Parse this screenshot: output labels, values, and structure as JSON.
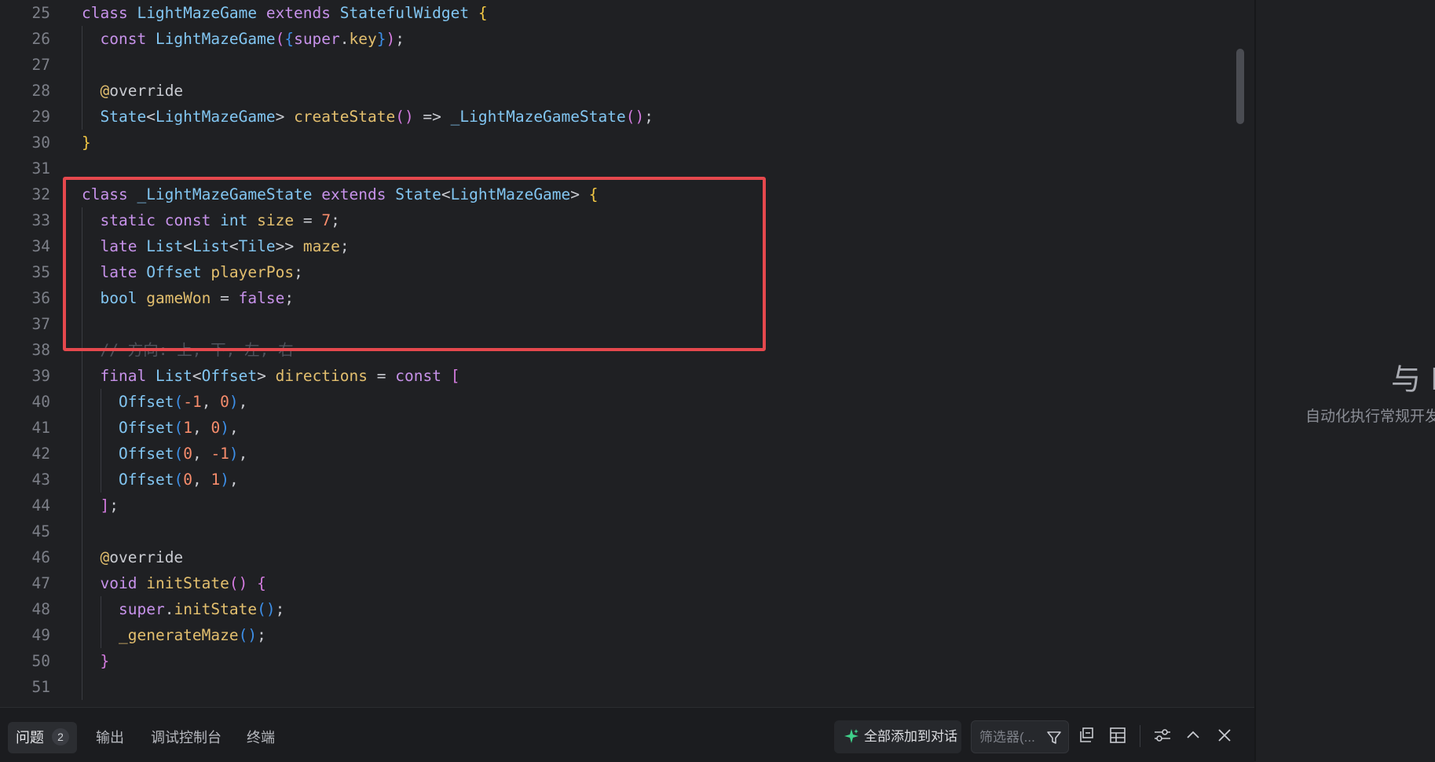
{
  "editor": {
    "lines": [
      {
        "n": "25",
        "indent": 0,
        "tokens": [
          [
            "class",
            "kw"
          ],
          [
            " ",
            ""
          ],
          [
            "LightMazeGame",
            "type"
          ],
          [
            " ",
            ""
          ],
          [
            "extends",
            "kw"
          ],
          [
            " ",
            ""
          ],
          [
            "StatefulWidget",
            "type"
          ],
          [
            " ",
            ""
          ],
          [
            "{",
            "b1"
          ]
        ]
      },
      {
        "n": "26",
        "indent": 1,
        "tokens": [
          [
            "const",
            "kw"
          ],
          [
            " ",
            ""
          ],
          [
            "LightMazeGame",
            "type"
          ],
          [
            "(",
            "b2"
          ],
          [
            "{",
            "b3"
          ],
          [
            "super",
            "kw"
          ],
          [
            ".",
            ""
          ],
          [
            "key",
            "fn"
          ],
          [
            "}",
            "b3"
          ],
          [
            ")",
            "b2"
          ],
          [
            ";",
            ""
          ]
        ]
      },
      {
        "n": "27",
        "indent": 1,
        "tokens": []
      },
      {
        "n": "28",
        "indent": 1,
        "tokens": [
          [
            "@",
            "ann"
          ],
          [
            "override",
            ""
          ]
        ]
      },
      {
        "n": "29",
        "indent": 1,
        "tokens": [
          [
            "State",
            "type"
          ],
          [
            "<",
            ""
          ],
          [
            "LightMazeGame",
            "type"
          ],
          [
            "> ",
            ""
          ],
          [
            "createState",
            "fn"
          ],
          [
            "()",
            "b2"
          ],
          [
            " => ",
            ""
          ],
          [
            "_LightMazeGameState",
            "type"
          ],
          [
            "()",
            "b2"
          ],
          [
            ";",
            ""
          ]
        ]
      },
      {
        "n": "30",
        "indent": 0,
        "tokens": [
          [
            "}",
            "b1"
          ]
        ]
      },
      {
        "n": "31",
        "indent": 0,
        "tokens": []
      },
      {
        "n": "32",
        "indent": 0,
        "tokens": [
          [
            "class",
            "kw"
          ],
          [
            " ",
            ""
          ],
          [
            "_LightMazeGameState",
            "type"
          ],
          [
            " ",
            ""
          ],
          [
            "extends",
            "kw"
          ],
          [
            " ",
            ""
          ],
          [
            "State",
            "type"
          ],
          [
            "<",
            ""
          ],
          [
            "LightMazeGame",
            "type"
          ],
          [
            "> ",
            ""
          ],
          [
            "{",
            "b1"
          ]
        ]
      },
      {
        "n": "33",
        "indent": 1,
        "tokens": [
          [
            "static",
            "kw"
          ],
          [
            " ",
            ""
          ],
          [
            "const",
            "kw"
          ],
          [
            " ",
            ""
          ],
          [
            "int",
            "type"
          ],
          [
            " ",
            ""
          ],
          [
            "size",
            "fn"
          ],
          [
            " = ",
            ""
          ],
          [
            "7",
            "num"
          ],
          [
            ";",
            ""
          ]
        ]
      },
      {
        "n": "34",
        "indent": 1,
        "tokens": [
          [
            "late",
            "kw"
          ],
          [
            " ",
            ""
          ],
          [
            "List",
            "type"
          ],
          [
            "<",
            ""
          ],
          [
            "List",
            "type"
          ],
          [
            "<",
            ""
          ],
          [
            "Tile",
            "type"
          ],
          [
            ">> ",
            ""
          ],
          [
            "maze",
            "fn"
          ],
          [
            ";",
            ""
          ]
        ]
      },
      {
        "n": "35",
        "indent": 1,
        "tokens": [
          [
            "late",
            "kw"
          ],
          [
            " ",
            ""
          ],
          [
            "Offset",
            "type"
          ],
          [
            " ",
            ""
          ],
          [
            "playerPos",
            "fn"
          ],
          [
            ";",
            ""
          ]
        ]
      },
      {
        "n": "36",
        "indent": 1,
        "tokens": [
          [
            "bool",
            "type"
          ],
          [
            " ",
            ""
          ],
          [
            "gameWon",
            "fn"
          ],
          [
            " = ",
            ""
          ],
          [
            "false",
            "kw"
          ],
          [
            ";",
            ""
          ]
        ]
      },
      {
        "n": "37",
        "indent": 1,
        "tokens": []
      },
      {
        "n": "38",
        "indent": 1,
        "tokens": [
          [
            "// 方向: 上, 下, 左, 右",
            "cmt"
          ]
        ]
      },
      {
        "n": "39",
        "indent": 1,
        "tokens": [
          [
            "final",
            "kw"
          ],
          [
            " ",
            ""
          ],
          [
            "List",
            "type"
          ],
          [
            "<",
            ""
          ],
          [
            "Offset",
            "type"
          ],
          [
            "> ",
            ""
          ],
          [
            "directions",
            "fn"
          ],
          [
            " = ",
            ""
          ],
          [
            "const",
            "kw"
          ],
          [
            " ",
            ""
          ],
          [
            "[",
            "b2"
          ]
        ]
      },
      {
        "n": "40",
        "indent": 2,
        "tokens": [
          [
            "Offset",
            "type"
          ],
          [
            "(",
            "b3"
          ],
          [
            "-1",
            "num"
          ],
          [
            ", ",
            ""
          ],
          [
            "0",
            "num"
          ],
          [
            ")",
            "b3"
          ],
          [
            ",",
            ""
          ]
        ]
      },
      {
        "n": "41",
        "indent": 2,
        "tokens": [
          [
            "Offset",
            "type"
          ],
          [
            "(",
            "b3"
          ],
          [
            "1",
            "num"
          ],
          [
            ", ",
            ""
          ],
          [
            "0",
            "num"
          ],
          [
            ")",
            "b3"
          ],
          [
            ",",
            ""
          ]
        ]
      },
      {
        "n": "42",
        "indent": 2,
        "tokens": [
          [
            "Offset",
            "type"
          ],
          [
            "(",
            "b3"
          ],
          [
            "0",
            "num"
          ],
          [
            ", ",
            ""
          ],
          [
            "-1",
            "num"
          ],
          [
            ")",
            "b3"
          ],
          [
            ",",
            ""
          ]
        ]
      },
      {
        "n": "43",
        "indent": 2,
        "tokens": [
          [
            "Offset",
            "type"
          ],
          [
            "(",
            "b3"
          ],
          [
            "0",
            "num"
          ],
          [
            ", ",
            ""
          ],
          [
            "1",
            "num"
          ],
          [
            ")",
            "b3"
          ],
          [
            ",",
            ""
          ]
        ]
      },
      {
        "n": "44",
        "indent": 1,
        "tokens": [
          [
            "]",
            "b2"
          ],
          [
            ";",
            ""
          ]
        ]
      },
      {
        "n": "45",
        "indent": 1,
        "tokens": []
      },
      {
        "n": "46",
        "indent": 1,
        "tokens": [
          [
            "@",
            "ann"
          ],
          [
            "override",
            ""
          ]
        ]
      },
      {
        "n": "47",
        "indent": 1,
        "tokens": [
          [
            "void",
            "kw"
          ],
          [
            " ",
            ""
          ],
          [
            "initState",
            "fn"
          ],
          [
            "()",
            "b2"
          ],
          [
            " ",
            ""
          ],
          [
            "{",
            "b2"
          ]
        ]
      },
      {
        "n": "48",
        "indent": 2,
        "tokens": [
          [
            "super",
            "kw"
          ],
          [
            ".",
            ""
          ],
          [
            "initState",
            "fn"
          ],
          [
            "()",
            "b3"
          ],
          [
            ";",
            ""
          ]
        ]
      },
      {
        "n": "49",
        "indent": 2,
        "tokens": [
          [
            "_generateMaze",
            "fn"
          ],
          [
            "()",
            "b3"
          ],
          [
            ";",
            ""
          ]
        ]
      },
      {
        "n": "50",
        "indent": 1,
        "tokens": [
          [
            "}",
            "b2"
          ]
        ]
      },
      {
        "n": "51",
        "indent": 1,
        "tokens": []
      }
    ]
  },
  "right_panel": {
    "title": "与 I",
    "subtitle": "自动化执行常规开发"
  },
  "bottom_panel": {
    "tabs": [
      {
        "label": "问题",
        "badge": "2",
        "active": true
      },
      {
        "label": "输出",
        "active": false
      },
      {
        "label": "调试控制台",
        "active": false
      },
      {
        "label": "终端",
        "active": false
      }
    ],
    "add_all_label": "全部添加到对话",
    "filter_placeholder": "筛选器(...",
    "icons": [
      "sparkle-icon",
      "filter-icon",
      "collapse-all-icon",
      "table-view-icon",
      "settings-sliders-icon",
      "chevron-up-icon",
      "close-icon"
    ]
  },
  "colors": {
    "background": "#1f2023",
    "highlight_box": "#e5484d",
    "keyword": "#c792ea",
    "type": "#82c6f2",
    "function": "#e3bf6e",
    "number": "#f78c6c"
  }
}
